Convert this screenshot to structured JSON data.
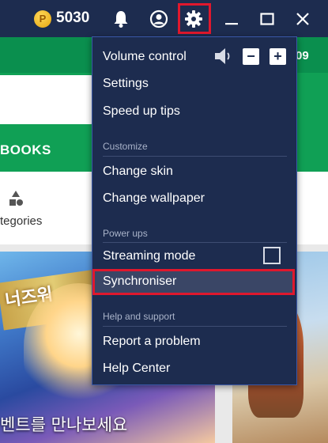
{
  "titlebar": {
    "coin_symbol": "P",
    "coin_count": "5030",
    "icons": [
      "bell-icon",
      "account-icon",
      "gear-icon",
      "minimize-icon",
      "maximize-icon",
      "close-icon"
    ]
  },
  "background": {
    "time_fragment": "09",
    "tab_fragment": "BOOKS",
    "categories_fragment": "tegories",
    "banner_text": "벤트를 만나보세요",
    "game_title_fragment": "너즈워"
  },
  "menu": {
    "volume_label": "Volume control",
    "volume_minus": "−",
    "volume_plus": "+",
    "settings_label": "Settings",
    "speedup_label": "Speed up tips",
    "customize_header": "Customize",
    "change_skin_label": "Change skin",
    "change_wallpaper_label": "Change wallpaper",
    "powerups_header": "Power ups",
    "streaming_label": "Streaming mode",
    "streaming_checked": false,
    "sync_label": "Synchroniser",
    "help_header": "Help and support",
    "report_label": "Report a problem",
    "help_center_label": "Help Center"
  },
  "colors": {
    "titlebar": "#1d2c4f",
    "menu_bg": "#1d2c4f",
    "highlight_border": "#e0182d",
    "green": "#0a8f4e"
  }
}
